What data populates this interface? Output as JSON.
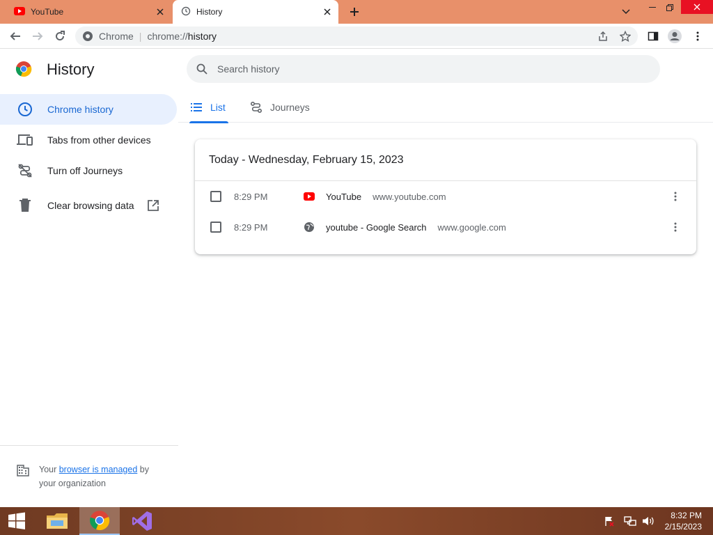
{
  "browser": {
    "tabs": [
      {
        "label": "YouTube",
        "icon": "youtube-icon"
      },
      {
        "label": "History",
        "icon": "history-clock-icon"
      }
    ],
    "omnibox": {
      "chip": "Chrome",
      "url_prefix": "chrome://",
      "url_host": "history"
    }
  },
  "page": {
    "title": "History",
    "search": {
      "placeholder": "Search history"
    },
    "sidebar": {
      "items": [
        {
          "label": "Chrome history",
          "icon": "clock-icon",
          "active": true
        },
        {
          "label": "Tabs from other devices",
          "icon": "devices-icon"
        },
        {
          "label": "Turn off Journeys",
          "icon": "journeys-off-icon"
        },
        {
          "label": "Clear browsing data",
          "icon": "trash-icon"
        }
      ]
    },
    "managed": {
      "pre": "Your ",
      "link": "browser is managed",
      "post": " by your organization"
    },
    "view_tabs": [
      {
        "label": "List",
        "icon": "list-icon",
        "active": true
      },
      {
        "label": "Journeys",
        "icon": "journeys-icon"
      }
    ],
    "day_header": "Today - Wednesday, February 15, 2023",
    "entries": [
      {
        "time": "8:29 PM",
        "title": "YouTube",
        "domain": "www.youtube.com",
        "favicon": "youtube-icon"
      },
      {
        "time": "8:29 PM",
        "title": "youtube - Google Search",
        "domain": "www.google.com",
        "favicon": "globe-icon"
      }
    ]
  },
  "taskbar": {
    "time": "8:32 PM",
    "date": "2/15/2023"
  },
  "colors": {
    "tabstrip": "#e8906a",
    "accent": "#1a73e8",
    "active_bg": "#e8f0fe",
    "close_red": "#e81123"
  }
}
